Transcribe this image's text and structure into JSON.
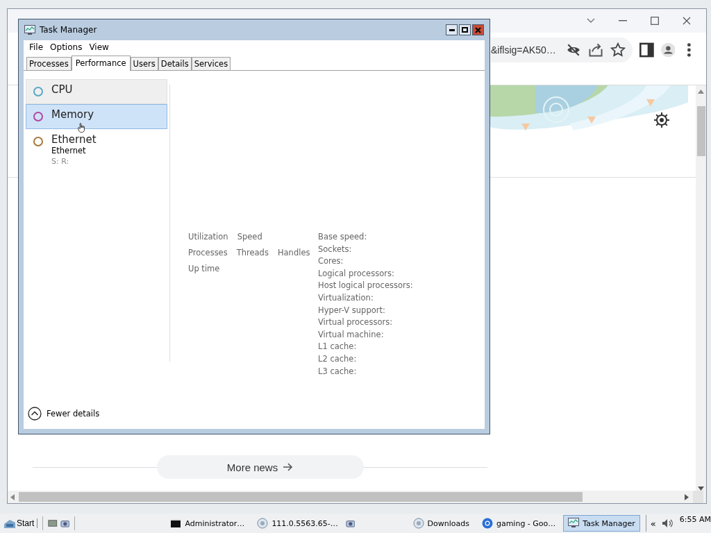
{
  "browser": {
    "url_fragment": "&iflsig=AK50…",
    "more_news": "More news"
  },
  "task_manager": {
    "title": "Task Manager",
    "menu": [
      "File",
      "Options",
      "View"
    ],
    "tabs": [
      {
        "label": "Processes",
        "selected": false
      },
      {
        "label": "Performance",
        "selected": true
      },
      {
        "label": "Users",
        "selected": false
      },
      {
        "label": "Details",
        "selected": false
      },
      {
        "label": "Services",
        "selected": false
      }
    ],
    "resources": [
      {
        "name": "CPU",
        "color": "#5aa9c6",
        "selected": false,
        "shaded": true
      },
      {
        "name": "Memory",
        "color": "#b0479f",
        "selected": true,
        "shaded": false
      },
      {
        "name": "Ethernet",
        "color": "#a8793a",
        "selected": false,
        "shaded": false,
        "subtitle": "Ethernet",
        "detail": "S: R:"
      }
    ],
    "stat_rows": [
      [
        "Utilization",
        "Speed"
      ],
      [
        "Processes",
        "Threads",
        "Handles"
      ],
      [
        "Up time"
      ]
    ],
    "specs": [
      "Base speed:",
      "Sockets:",
      "Cores:",
      "Logical processors:",
      "Host logical processors:",
      "Virtualization:",
      "Hyper-V support:",
      "Virtual processors:",
      "Virtual machine:",
      "L1 cache:",
      "L2 cache:",
      "L3 cache:"
    ],
    "fewer_details": "Fewer details"
  },
  "taskbar": {
    "start": "Start",
    "tasks": [
      {
        "kind": "console",
        "label": "Administrator…",
        "selected": false
      },
      {
        "kind": "installer",
        "label": "111.0.5563.65-…",
        "selected": false
      },
      {
        "kind": "camera"
      },
      {
        "kind": "installer",
        "label": "Downloads",
        "selected": false
      },
      {
        "kind": "chrome",
        "label": "gaming - Goo…",
        "selected": false
      },
      {
        "kind": "monitor",
        "label": "Task Manager",
        "selected": true
      }
    ],
    "tray_toggle": "«",
    "clock": "6:55 AM"
  }
}
